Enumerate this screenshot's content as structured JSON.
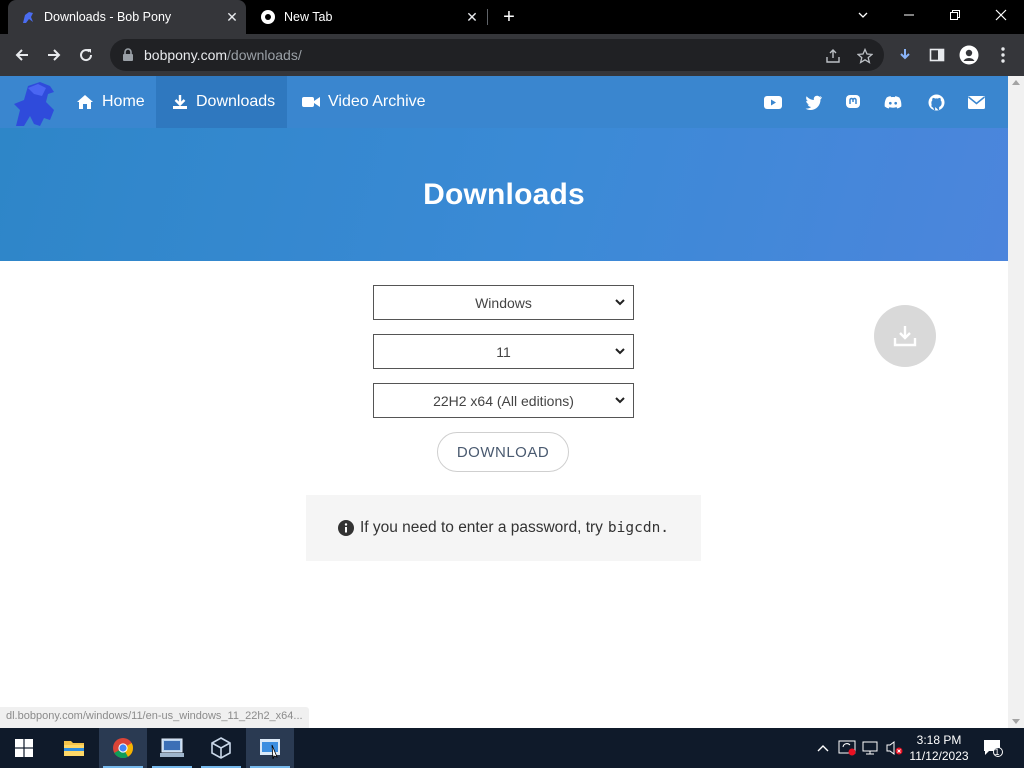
{
  "browser": {
    "tabs": [
      {
        "title": "Downloads - Bob Pony",
        "active": true
      },
      {
        "title": "New Tab",
        "active": false
      }
    ],
    "url_host": "bobpony.com",
    "url_path": "/downloads/"
  },
  "site": {
    "nav": {
      "home_label": "Home",
      "downloads_label": "Downloads",
      "video_archive_label": "Video Archive"
    },
    "social_icons": [
      "youtube-icon",
      "twitter-icon",
      "mastodon-icon",
      "discord-icon",
      "github-icon",
      "mail-icon"
    ],
    "hero_title": "Downloads",
    "selects": {
      "os": "Windows",
      "version": "11",
      "build": "22H2 x64 (All editions)"
    },
    "download_button": "DOWNLOAD",
    "notice": {
      "text": "If you need to enter a password, try",
      "password": "bigcdn."
    }
  },
  "status_url": "dl.bobpony.com/windows/11/en-us_windows_11_22h2_x64...",
  "taskbar": {
    "apps": [
      "file-explorer-icon",
      "chrome-icon",
      "network-app-icon",
      "virtualbox-icon",
      "snipping-tool-icon"
    ],
    "clock_time": "3:18 PM",
    "clock_date": "11/12/2023",
    "notification_count": "1"
  },
  "colors": {
    "nav_bg": "#3a86cf",
    "hero_gradient_start": "#2e86c8",
    "hero_gradient_end": "#4c85dc",
    "taskbar_bg": "#0f1a2a"
  }
}
